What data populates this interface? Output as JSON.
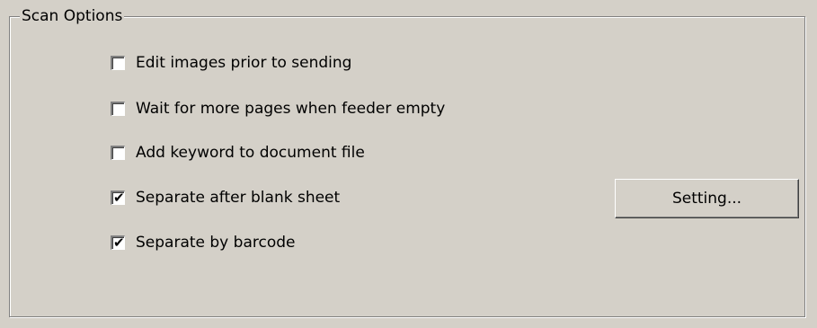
{
  "group": {
    "title": "Scan Options"
  },
  "options": [
    {
      "label": "Edit images prior to sending",
      "checked": false
    },
    {
      "label": "Wait for more pages when feeder empty",
      "checked": false
    },
    {
      "label": "Add keyword to document file",
      "checked": false
    },
    {
      "label": "Separate after blank sheet",
      "checked": true
    },
    {
      "label": "Separate by barcode",
      "checked": true
    }
  ],
  "setting_button": {
    "label": "Setting..."
  },
  "checkmark_glyph": "✔",
  "colors": {
    "dialog_background": "#d4d0c8",
    "checkbox_background": "#ffffff",
    "border_shadow": "#808080",
    "border_highlight": "#ffffff"
  }
}
